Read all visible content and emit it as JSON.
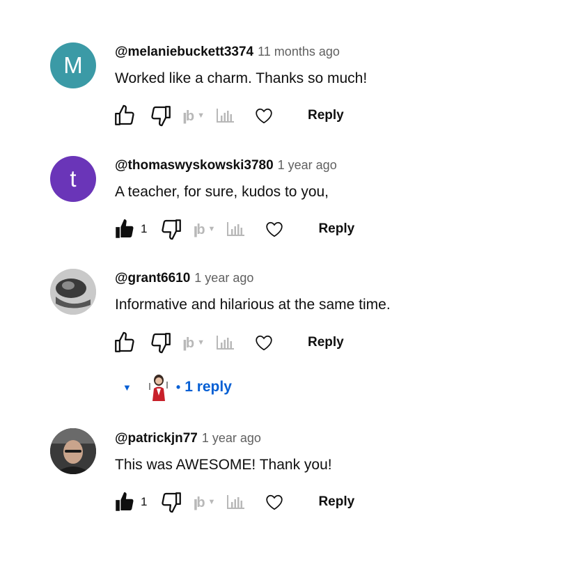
{
  "comments": [
    {
      "avatar_letter": "M",
      "avatar_color": "#3b9aa6",
      "author": "@melaniebuckett3374",
      "time": "11 months ago",
      "text": "Worked like a charm.  Thanks so much!",
      "likes": "",
      "reply_label": "Reply"
    },
    {
      "avatar_letter": "t",
      "avatar_color": "#6a35b8",
      "author": "@thomaswyskowski3780",
      "time": "1 year ago",
      "text": "A teacher, for sure, kudos to you,",
      "likes": "1",
      "reply_label": "Reply"
    },
    {
      "avatar_letter": "",
      "author": "@grant6610",
      "time": "1 year ago",
      "text": "Informative and hilarious at the same time.",
      "likes": "",
      "reply_label": "Reply",
      "replies_label": "1 reply"
    },
    {
      "avatar_letter": "",
      "author": "@patrickjn77",
      "time": "1 year ago",
      "text": "This was AWESOME! Thank you!",
      "likes": "1",
      "reply_label": "Reply"
    }
  ],
  "icons": {
    "like": "thumbs-up-icon",
    "dislike": "thumbs-down-icon",
    "tubebuddy": "tubebuddy-icon",
    "stats": "bar-chart-icon",
    "heart": "heart-icon",
    "expand": "caret-down-icon"
  },
  "colors": {
    "link_blue": "#065fd4",
    "meta_gray": "#606060"
  }
}
